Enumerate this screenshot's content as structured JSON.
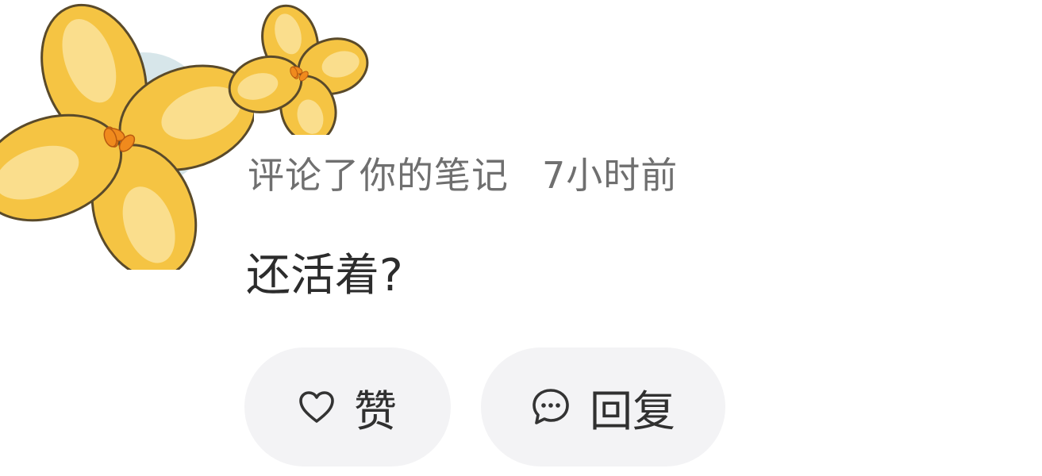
{
  "notification": {
    "action_text": "评论了你的笔记",
    "time_text": "7小时前",
    "comment_text": "还活着?"
  },
  "actions": {
    "like_label": "赞",
    "reply_label": "回复"
  },
  "icons": {
    "like": "heart-icon",
    "reply": "chat-bubble-icon",
    "avatar_decoration": "yellow-flower-icon"
  },
  "colors": {
    "flower_fill": "#f5c443",
    "flower_light": "#fbe39a",
    "flower_center": "#f08a1d",
    "avatar_bg": "#d7e6ea",
    "pill_bg": "#f3f3f5",
    "meta_text": "#6f6f6f",
    "body_text": "#2c2c2c"
  }
}
